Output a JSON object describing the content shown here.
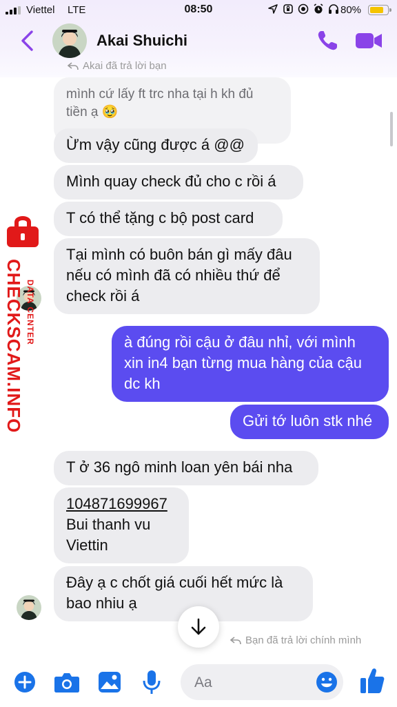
{
  "status_bar": {
    "carrier": "Viettel",
    "network": "LTE",
    "time": "08:50",
    "battery": "80%",
    "battery_level": 0.8
  },
  "header": {
    "contact_name": "Akai Shuichi"
  },
  "messages": {
    "reply_note_top": "Akai đã trả lời bạn",
    "m1": "mình cứ lấy ft trc nha tại h kh đủ",
    "m1b": "tiền ạ 🥹",
    "m2": "Ừm vậy cũng được á @@",
    "m3": "Mình quay check đủ cho c rồi á",
    "m4": "T có thể tặng c bộ post card",
    "m5_l1": "Tại mình có buôn bán gì mấy đâu",
    "m5_l2": "nếu có mình đã có nhiều thứ để",
    "m5_l3": "check rồi á",
    "o1_l1": "à đúng rồi cậu ở đâu nhỉ, với mình",
    "o1_l2": "xin in4 bạn từng mua hàng của cậu",
    "o1_l3": "dc kh",
    "o2": "Gửi tớ luôn stk nhé",
    "m6": "T ở 36 ngô minh loan yên bái nha",
    "m7_l1": "104871699967",
    "m7_l2": "Bui thanh vu",
    "m7_l3": "Viettin",
    "m8_l1": "Đây ạ c chốt giá cuối hết mức là",
    "m8_l2": "bao nhiu ạ",
    "reply_note_bottom": "Bạn đã trả lời chính mình"
  },
  "composer": {
    "placeholder": "Aa"
  },
  "watermark": {
    "brand": "CHECKSCAM.INFO",
    "tag": "DATA CENTER"
  },
  "colors": {
    "accent": "#5b4cf0",
    "icon_purple": "#8a43e8",
    "icon_blue": "#1a73e8",
    "watermark_red": "#e11919"
  }
}
